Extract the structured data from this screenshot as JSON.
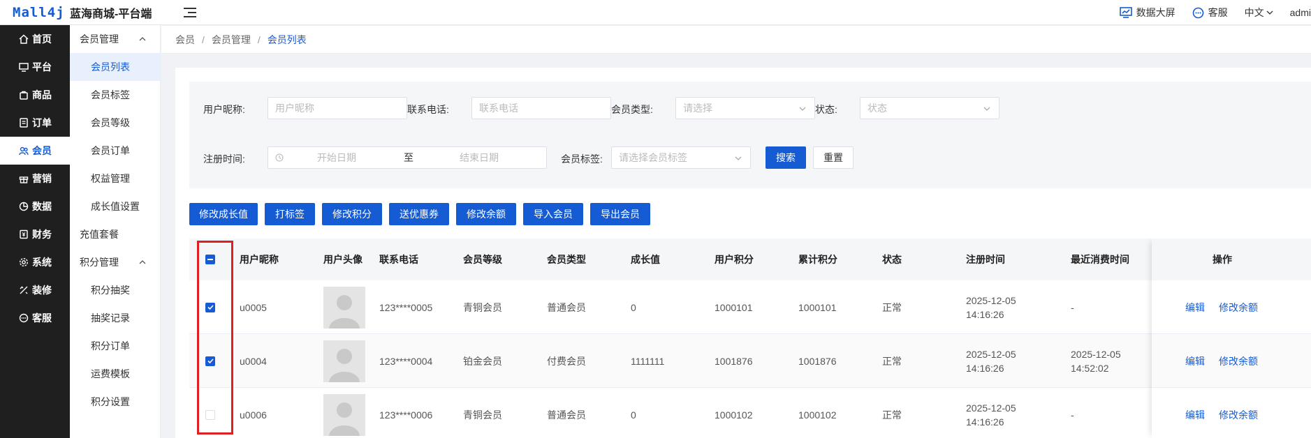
{
  "header": {
    "logo": "Mall4j",
    "brand": "蓝海商城-平台端",
    "right": [
      {
        "icon": "chart-screen-icon",
        "label": "数据大屏"
      },
      {
        "icon": "chat-icon",
        "label": "客服"
      },
      {
        "icon": "chevron-down-icon",
        "label": "中文"
      },
      {
        "icon": "",
        "label": "admi"
      }
    ]
  },
  "sidebar": [
    {
      "icon": "home-icon",
      "label": "首页"
    },
    {
      "icon": "monitor-icon",
      "label": "平台"
    },
    {
      "icon": "bag-icon",
      "label": "商品"
    },
    {
      "icon": "order-icon",
      "label": "订单"
    },
    {
      "icon": "users-icon",
      "label": "会员",
      "active": true
    },
    {
      "icon": "gift-icon",
      "label": "营销"
    },
    {
      "icon": "data-icon",
      "label": "数据"
    },
    {
      "icon": "finance-icon",
      "label": "财务"
    },
    {
      "icon": "gear-icon",
      "label": "系统"
    },
    {
      "icon": "decorate-icon",
      "label": "装修"
    },
    {
      "icon": "service-icon",
      "label": "客服"
    }
  ],
  "submenu": {
    "group1": "会员管理",
    "items1": [
      "会员列表",
      "会员标签",
      "会员等级",
      "会员订单",
      "权益管理",
      "成长值设置"
    ],
    "single": "充值套餐",
    "group2": "积分管理",
    "items2": [
      "积分抽奖",
      "抽奖记录",
      "积分订单",
      "运费模板",
      "积分设置"
    ]
  },
  "breadcrumb": [
    "会员",
    "会员管理",
    "会员列表"
  ],
  "filters": {
    "nickname_label": "用户昵称:",
    "nickname_placeholder": "用户昵称",
    "phone_label": "联系电话:",
    "phone_placeholder": "联系电话",
    "type_label": "会员类型:",
    "type_placeholder": "请选择",
    "status_label": "状态:",
    "status_placeholder": "状态",
    "regtime_label": "注册时间:",
    "start_placeholder": "开始日期",
    "range_sep": "至",
    "end_placeholder": "结束日期",
    "tag_label": "会员标签:",
    "tag_placeholder": "请选择会员标签",
    "search": "搜索",
    "reset": "重置"
  },
  "actions": [
    "修改成长值",
    "打标签",
    "修改积分",
    "送优惠券",
    "修改余额",
    "导入会员",
    "导出会员"
  ],
  "table": {
    "columns": [
      "用户昵称",
      "用户头像",
      "联系电话",
      "会员等级",
      "会员类型",
      "成长值",
      "用户积分",
      "累计积分",
      "状态",
      "注册时间",
      "最近消费时间",
      "操作"
    ],
    "rows": [
      {
        "checked": true,
        "nickname": "u0005",
        "phone": "123****0005",
        "level": "青铜会员",
        "type": "普通会员",
        "growth": "0",
        "points": "1000101",
        "total_points": "1000101",
        "status": "正常",
        "reg_date": "2025-12-05",
        "reg_time": "14:16:26",
        "last_date": "-",
        "last_time": ""
      },
      {
        "checked": true,
        "nickname": "u0004",
        "phone": "123****0004",
        "level": "铂金会员",
        "type": "付费会员",
        "growth": "1111111",
        "points": "1001876",
        "total_points": "1001876",
        "status": "正常",
        "reg_date": "2025-12-05",
        "reg_time": "14:16:26",
        "last_date": "2025-12-05",
        "last_time": "14:52:02"
      },
      {
        "checked": false,
        "nickname": "u0006",
        "phone": "123****0006",
        "level": "青铜会员",
        "type": "普通会员",
        "growth": "0",
        "points": "1000102",
        "total_points": "1000102",
        "status": "正常",
        "reg_date": "2025-12-05",
        "reg_time": "14:16:26",
        "last_date": "-",
        "last_time": ""
      }
    ],
    "op_edit": "编辑",
    "op_balance": "修改余额"
  },
  "colors": {
    "primary": "#155bd4",
    "sidebar_bg": "#1f1f1f",
    "highlight": "#e02020"
  }
}
